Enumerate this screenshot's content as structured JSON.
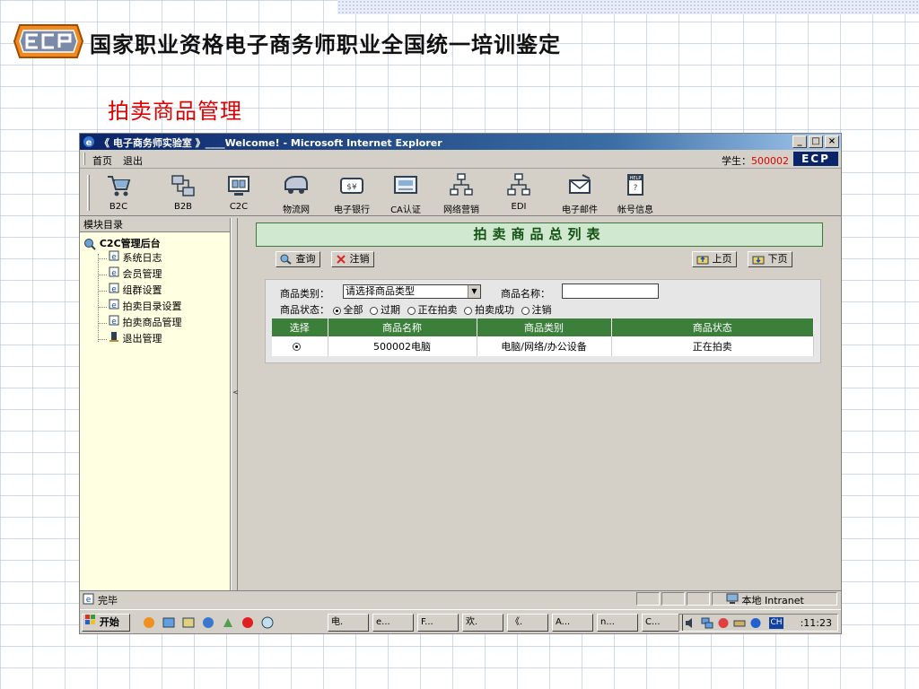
{
  "slide": {
    "title": "国家职业资格电子商务师职业全国统一培训鉴定",
    "subtitle": "拍卖商品管理"
  },
  "window": {
    "title": "《 电子商务师实验室 》____Welcome! - Microsoft Internet Explorer",
    "controls": [
      "_",
      "□",
      "×"
    ]
  },
  "menu": {
    "items": [
      "首页",
      "退出"
    ],
    "student_label": "学生：",
    "student_id": "500002",
    "badge": "ECP"
  },
  "toolbar": {
    "buttons": [
      {
        "label": "B2C",
        "icon": "cart-icon"
      },
      {
        "label": "B2B",
        "icon": "network-icon"
      },
      {
        "label": "C2C",
        "icon": "exchange-icon"
      },
      {
        "label": "物流网",
        "icon": "truck-icon"
      },
      {
        "label": "电子银行",
        "icon": "bank-icon"
      },
      {
        "label": "CA认证",
        "icon": "certificate-icon"
      },
      {
        "label": "网络营销",
        "icon": "org-chart-icon"
      },
      {
        "label": "EDI",
        "icon": "edi-icon"
      },
      {
        "label": "电子邮件",
        "icon": "email-icon"
      },
      {
        "label": "帐号信息",
        "icon": "help-book-icon"
      }
    ]
  },
  "sidebar": {
    "header": "模块目录",
    "root": "C2C管理后台",
    "items": [
      "系统日志",
      "会员管理",
      "组群设置",
      "拍卖目录设置",
      "拍卖商品管理",
      "退出管理"
    ]
  },
  "main": {
    "list_title": "拍卖商品总列表",
    "query_label": "查询",
    "cancel_label": "注销",
    "prev_label": "上页",
    "next_label": "下页",
    "category_label": "商品类别：",
    "category_value": "请选择商品类型",
    "name_label": "商品名称：",
    "name_value": "",
    "status_label": "商品状态：",
    "status_options": [
      {
        "label": "全部",
        "checked": true
      },
      {
        "label": "过期",
        "checked": false
      },
      {
        "label": "正在拍卖",
        "checked": false
      },
      {
        "label": "拍卖成功",
        "checked": false
      },
      {
        "label": "注销",
        "checked": false
      }
    ],
    "table": {
      "headers": [
        "选择",
        "商品名称",
        "商品类别",
        "商品状态"
      ],
      "rows": [
        {
          "selected": true,
          "name": "500002电脑",
          "category": "电脑/网络/办公设备",
          "status": "正在拍卖"
        }
      ]
    }
  },
  "statusbar": {
    "text": "完毕",
    "zone": "本地 Intranet"
  },
  "taskbar": {
    "start": "开始",
    "tasks": [
      "电.",
      "e...",
      "F...",
      "欢.",
      "《.",
      "A...",
      "n...",
      "C..."
    ],
    "lang": "CH",
    "clock": ":11:23"
  },
  "colors": {
    "header_green": "#3b7f3b",
    "title_red": "#e00000",
    "titlebar_blue": "#0a246a"
  }
}
